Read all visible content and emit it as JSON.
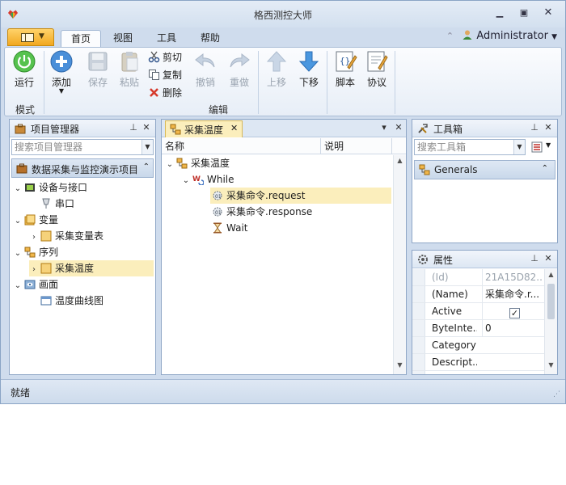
{
  "window": {
    "title": "格西测控大师"
  },
  "ribbon": {
    "tabs": [
      {
        "label": "首页",
        "active": true
      },
      {
        "label": "视图"
      },
      {
        "label": "工具"
      },
      {
        "label": "帮助"
      }
    ],
    "user": "Administrator",
    "groups": {
      "mode": {
        "label": "模式",
        "run": "运行"
      },
      "edit": {
        "label": "编辑",
        "add": "添加",
        "save": "保存",
        "paste": "粘贴",
        "cut": "剪切",
        "copy": "复制",
        "delete": "删除",
        "undo": "撤销",
        "redo": "重做",
        "move_up": "上移",
        "move_down": "下移"
      },
      "extra": {
        "script": "脚本",
        "protocol": "协议"
      }
    }
  },
  "project_panel": {
    "title": "项目管理器",
    "search_placeholder": "搜索项目管理器",
    "project_name": "数据采集与监控演示项目",
    "tree": [
      {
        "label": "设备与接口",
        "icon": "device-icon",
        "expanded": true,
        "level": 0
      },
      {
        "label": "串口",
        "icon": "serial-port-icon",
        "level": 1
      },
      {
        "label": "变量",
        "icon": "variable-folder-icon",
        "expanded": true,
        "level": 0
      },
      {
        "label": "采集变量表",
        "icon": "variable-table-icon",
        "level": 1,
        "expandable": true
      },
      {
        "label": "序列",
        "icon": "sequence-icon",
        "expanded": true,
        "level": 0
      },
      {
        "label": "采集温度",
        "icon": "sequence-item-icon",
        "level": 1,
        "expandable": true,
        "selected": true
      },
      {
        "label": "画面",
        "icon": "screen-icon",
        "expanded": true,
        "level": 0
      },
      {
        "label": "温度曲线图",
        "icon": "chart-window-icon",
        "level": 1
      }
    ]
  },
  "document": {
    "tab_title": "采集温度",
    "columns": {
      "name": "名称",
      "desc": "说明"
    },
    "tree": [
      {
        "label": "采集温度",
        "icon": "sequence-icon",
        "level": 0
      },
      {
        "label": "While",
        "icon": "while-loop-icon",
        "level": 1
      },
      {
        "label": "采集命令.request",
        "icon": "command-icon",
        "level": 2,
        "selected": true
      },
      {
        "label": "采集命令.response",
        "icon": "command-icon",
        "level": 2
      },
      {
        "label": "Wait",
        "icon": "hourglass-icon",
        "level": 2
      }
    ]
  },
  "toolbox": {
    "title": "工具箱",
    "search_placeholder": "搜索工具箱",
    "category": "Generals"
  },
  "properties": {
    "title": "属性",
    "rows": [
      {
        "name": "(Id)",
        "value": "21A15D82...",
        "readonly": true
      },
      {
        "name": "(Name)",
        "value": "采集命令.r..."
      },
      {
        "name": "Active",
        "value": "",
        "checkbox": true,
        "checked": true
      },
      {
        "name": "ByteInte...",
        "value": "0"
      },
      {
        "name": "Category",
        "value": ""
      },
      {
        "name": "Descript...",
        "value": ""
      }
    ]
  },
  "status": {
    "text": "就绪"
  }
}
